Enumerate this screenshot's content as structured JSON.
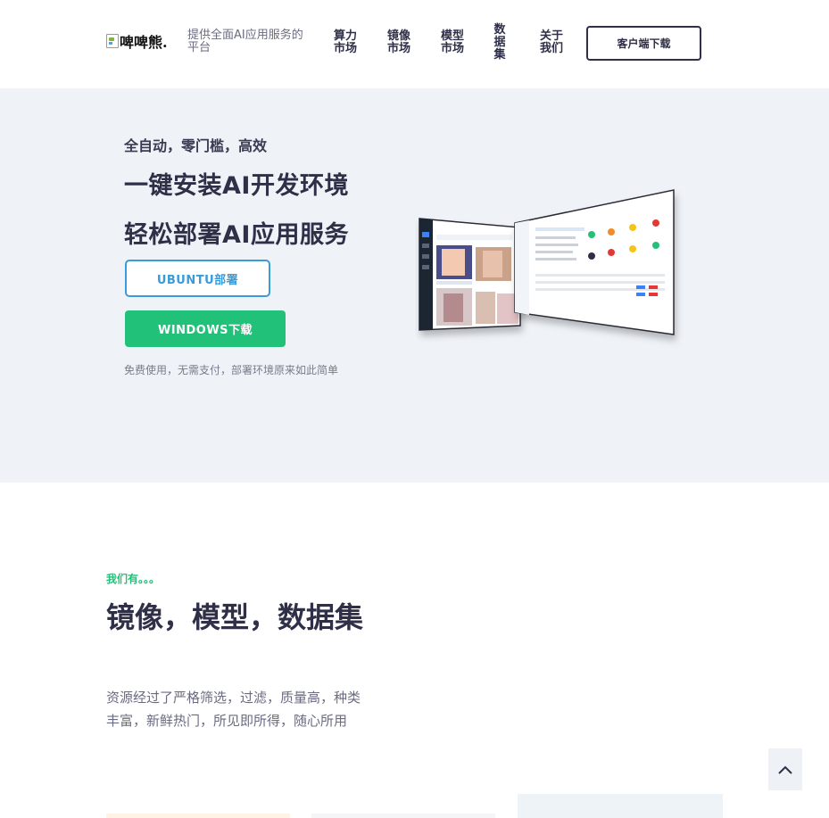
{
  "header": {
    "logo_alt": "啤啤熊.",
    "tagline": "提供全面AI应用服务的平台",
    "nav": [
      {
        "line1": "算力",
        "line2": "市场"
      },
      {
        "line1": "镜像",
        "line2": "市场"
      },
      {
        "line1": "模型",
        "line2": "市场"
      },
      {
        "line1": "数据集",
        "line2": ""
      },
      {
        "line1": "关于",
        "line2": "我们"
      }
    ],
    "client_download": "客户端下载"
  },
  "hero": {
    "eyebrow": "全自动，零门槛，高效",
    "headline1": "一键安装AI开发环境",
    "headline2": "轻松部署AI应用服务",
    "ubuntu_button": "UBUNTU部署",
    "windows_button": "WINDOWS下载",
    "note": "免费使用，无需支付，部署环境原来如此简单"
  },
  "features": {
    "eyebrow": "我们有。。。",
    "title": "镜像，模型，数据集",
    "description": "资源经过了严格筛选，过滤，质量高，种类丰富，新鲜热门，所见即所得，随心所用"
  },
  "colors": {
    "primary_green": "#22c17a",
    "ubuntu_blue": "#3a9bd9",
    "dark_text": "#2f2f48",
    "hero_bg": "#eff3f8"
  },
  "icons": {
    "scroll_top": "chevron-up-icon"
  }
}
